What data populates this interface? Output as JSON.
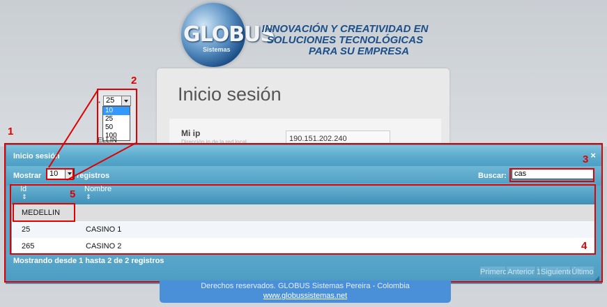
{
  "header": {
    "logo_text": "GLOBUS",
    "logo_sub": "Sistemas",
    "tagline": [
      "INNOVACIÓN Y CREATIVIDAD EN",
      "SOLUCIONES TECNOLÓGICAS",
      "PARA SU EMPRESA"
    ]
  },
  "login": {
    "title": "Inicio sesión",
    "ip_label": "Mi ip",
    "ip_hint": "Dirección ip de la red local",
    "ip_value": "190.151.202.240"
  },
  "dropdown_zoom": {
    "selected": "25",
    "options": [
      "10",
      "25",
      "50",
      "100"
    ],
    "highlighted_option": "10",
    "background_text": "ELLIN"
  },
  "annotations": [
    "1",
    "2",
    "3",
    "4",
    "5"
  ],
  "dialog": {
    "title": "Inicio sesión",
    "close_symbol": "×",
    "show_label": "Mostrar",
    "records_label": "registros",
    "length_value": "10",
    "search_label": "Buscar:",
    "search_value": "cas",
    "columns": [
      "Id",
      "Nombre"
    ],
    "group_row": "MEDELLIN",
    "rows": [
      {
        "id": "25",
        "name": "CASINO 1"
      },
      {
        "id": "265",
        "name": "CASINO 2"
      }
    ],
    "info": "Mostrando desde 1 hasta 2 de 2 registros",
    "pager": [
      "Primero",
      "Anterior",
      "1",
      "Siguiente",
      "Último"
    ]
  },
  "footer": {
    "text": "Derechos reservados. GLOBUS Sistemas Pereira - Colombia",
    "link": "www.globussistemas.net"
  },
  "colors": {
    "annotation_red": "#e00000",
    "dialog_blue": "#5aa7c8",
    "footer_blue": "#4a90d9"
  }
}
